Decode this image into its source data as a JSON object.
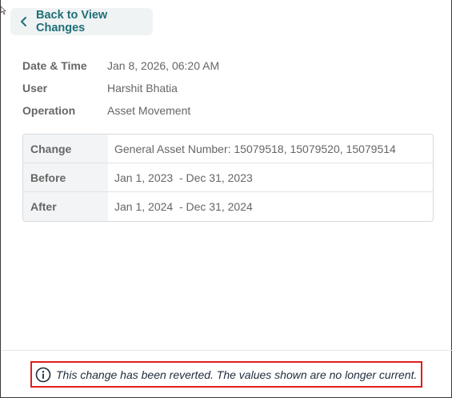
{
  "back_button": {
    "label": "Back to View Changes",
    "icon": "chevron-left-icon"
  },
  "meta": [
    {
      "key": "Date & Time",
      "value": "Jan 8, 2026, 06:20 AM"
    },
    {
      "key": "User",
      "value": "Harshit Bhatia"
    },
    {
      "key": "Operation",
      "value": "Asset Movement"
    }
  ],
  "table": [
    {
      "key": "Change",
      "value": "General Asset Number: 15079518, 15079520, 15079514"
    },
    {
      "key": "Before",
      "value": "Jan 1, 2023  - Dec 31, 2023"
    },
    {
      "key": "After",
      "value": "Jan 1, 2024  - Dec 31, 2024"
    }
  ],
  "notice": {
    "icon": "info-icon",
    "text": "This change has been reverted. The values shown are no longer current.",
    "highlight_color": "#e01e1e"
  },
  "colors": {
    "accent": "#1f6f77"
  }
}
